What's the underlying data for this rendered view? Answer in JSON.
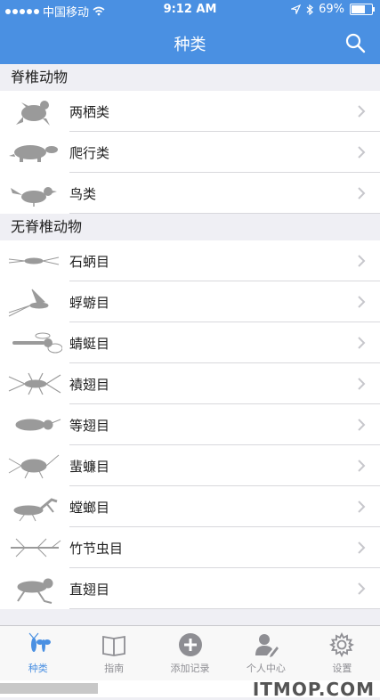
{
  "status": {
    "carrier": "中国移动",
    "time": "9:12 AM",
    "battery": "69%",
    "battery_level": 0.69
  },
  "nav": {
    "title": "种类"
  },
  "sections": [
    {
      "title": "脊椎动物",
      "items": [
        "两栖类",
        "爬行类",
        "鸟类"
      ]
    },
    {
      "title": "无脊椎动物",
      "items": [
        "石蛃目",
        "蜉蝣目",
        "蜻蜓目",
        "襀翅目",
        "等翅目",
        "蜚蠊目",
        "螳螂目",
        "竹节虫目",
        "直翅目"
      ]
    }
  ],
  "tabs": [
    {
      "label": "种类",
      "icon": "insects-icon",
      "active": true
    },
    {
      "label": "指南",
      "icon": "book-icon"
    },
    {
      "label": "添加记录",
      "icon": "add-circle-icon"
    },
    {
      "label": "个人中心",
      "icon": "person-edit-icon"
    },
    {
      "label": "设置",
      "icon": "gear-icon"
    }
  ],
  "watermark": "ITMOP.COM",
  "colors": {
    "accent": "#4a90e2",
    "silhouette": "#9a9a9a",
    "chevron": "#c7c7cc"
  }
}
